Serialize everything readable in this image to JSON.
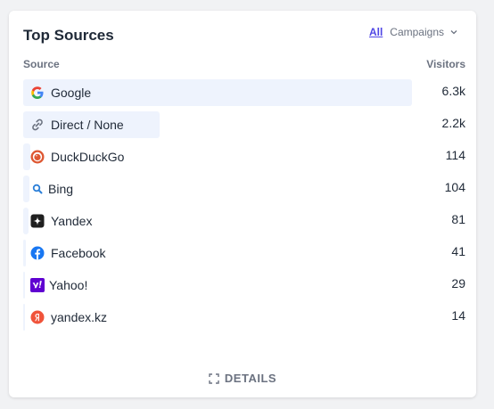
{
  "header": {
    "title": "Top Sources",
    "tab_all": "All",
    "tab_campaigns": "Campaigns"
  },
  "columns": {
    "source": "Source",
    "visitors": "Visitors"
  },
  "rows": [
    {
      "label": "Google",
      "value": "6.3k",
      "share": 1.0,
      "icon": "google-icon"
    },
    {
      "label": "Direct / None",
      "value": "2.2k",
      "share": 0.35,
      "icon": "link-icon"
    },
    {
      "label": "DuckDuckGo",
      "value": "114",
      "share": 0.018,
      "icon": "duckduckgo-icon"
    },
    {
      "label": "Bing",
      "value": "104",
      "share": 0.016,
      "icon": "bing-search-icon"
    },
    {
      "label": "Yandex",
      "value": "81",
      "share": 0.013,
      "icon": "yandex-icon"
    },
    {
      "label": "Facebook",
      "value": "41",
      "share": 0.0065,
      "icon": "facebook-icon"
    },
    {
      "label": "Yahoo!",
      "value": "29",
      "share": 0.0046,
      "icon": "yahoo-icon"
    },
    {
      "label": "yandex.kz",
      "value": "14",
      "share": 0.0022,
      "icon": "yandex-kz-icon"
    }
  ],
  "footer": {
    "details_label": "DETAILS"
  },
  "colors": {
    "accent": "#4f46e5",
    "bar": "#eef3fd",
    "text": "#1f2937",
    "muted": "#6b7280"
  }
}
